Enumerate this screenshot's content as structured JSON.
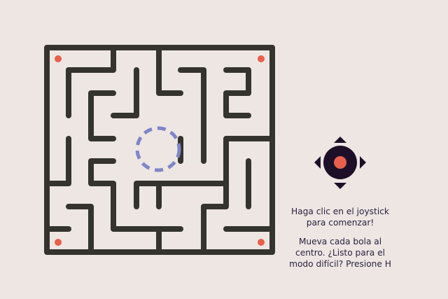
{
  "game": {
    "colors": {
      "background": "#EDE6E3",
      "wall": "#34332E",
      "ball": "#E8604A",
      "target_ring": "#7E86C6",
      "joystick_base": "#1E0F28",
      "joystick_arrows": "#1E0F28",
      "text": "#2A2240"
    },
    "balls_count": 4,
    "instructions": {
      "line1": "Haga clic en el joystick",
      "line2": "para comenzar!",
      "line3": "Mueva cada bola al",
      "line4": "centro. ¿Listo para el",
      "line5": "modo difícil? Presione H"
    },
    "joystick": {
      "icon": "joystick-icon",
      "arrows": [
        "up-arrow-icon",
        "down-arrow-icon",
        "left-arrow-icon",
        "right-arrow-icon"
      ]
    }
  }
}
